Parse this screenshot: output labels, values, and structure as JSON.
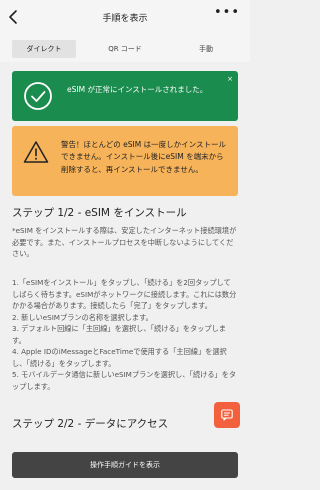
{
  "header": {
    "title": "手順を表示",
    "more_label": "•••"
  },
  "tabs": [
    {
      "label": "ダイレクト",
      "active": true
    },
    {
      "label": "QR コード",
      "active": false
    },
    {
      "label": "手動",
      "active": false
    }
  ],
  "success_alert": {
    "message": "eSIM が正常にインストールされました。",
    "close_label": "×",
    "color": "#1a8c4e"
  },
  "warning_alert": {
    "message": "警告！ほとんどの eSIM は一度しかインストールできません。インストール後にeSIM を端末から削除すると、再インストールできません。",
    "color": "#f6b35a"
  },
  "step1": {
    "title": "ステップ 1/2 - eSIM をインストール",
    "intro": "*eSIM をインストールする際は、安定したインターネット接続環境が必要です。また、インストールプロセスを中断しないようにしてください。",
    "items": [
      "1.「eSIMをインストール」をタップし、「続ける」を2回タップしてしばらく待ちます。eSIMがネットワークに接続します。これには数分かかる場合があります。接続したら「完了」をタップします。",
      "2. 新しいeSIMプランの名称を選択します。",
      "3. デフォルト回線に「主回線」を選択し、「続ける」をタップします。",
      "4. Apple IDのiMessageとFaceTimeで使用する「主回線」を選択し、「続ける」をタップします。",
      "5. モバイルデータ通信に新しいeSIMプランを選択し、「続ける」をタップします。"
    ]
  },
  "step2": {
    "title": "ステップ 2/2 - データにアクセス"
  },
  "bottom": {
    "button_label": "操作手順ガイドを表示"
  },
  "fab": {
    "icon": "chat-icon",
    "color": "#f2603e"
  }
}
